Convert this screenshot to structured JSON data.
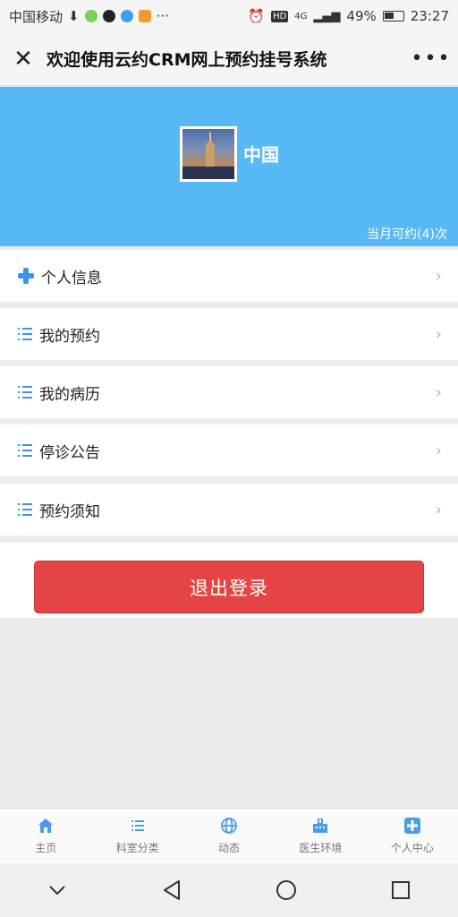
{
  "status_bar": {
    "carrier": "中国移动",
    "right_text": "49%",
    "time": "23:27",
    "hd": "HD",
    "net": "4G"
  },
  "title_bar": {
    "title": "欢迎使用云约CRM网上预约挂号系统",
    "close_icon": "close-icon",
    "more_icon": "more-icon"
  },
  "profile": {
    "name": "中国",
    "quota": "当月可约(4)次"
  },
  "menu": [
    {
      "label": "个人信息",
      "icon": "medical-cross-icon"
    },
    {
      "label": "我的预约",
      "icon": "list-icon"
    },
    {
      "label": "我的病历",
      "icon": "list-icon"
    },
    {
      "label": "停诊公告",
      "icon": "list-icon"
    },
    {
      "label": "预约须知",
      "icon": "list-icon"
    }
  ],
  "logout_label": "退出登录",
  "tabs": [
    {
      "label": "主页",
      "icon": "home-icon"
    },
    {
      "label": "科室分类",
      "icon": "list-icon"
    },
    {
      "label": "动态",
      "icon": "globe-icon"
    },
    {
      "label": "医生环境",
      "icon": "hospital-icon"
    },
    {
      "label": "个人中心",
      "icon": "medical-cross-icon"
    }
  ],
  "colors": {
    "accent": "#57b9f5",
    "icon_blue": "#3a95ef",
    "logout_red": "#e44444"
  }
}
